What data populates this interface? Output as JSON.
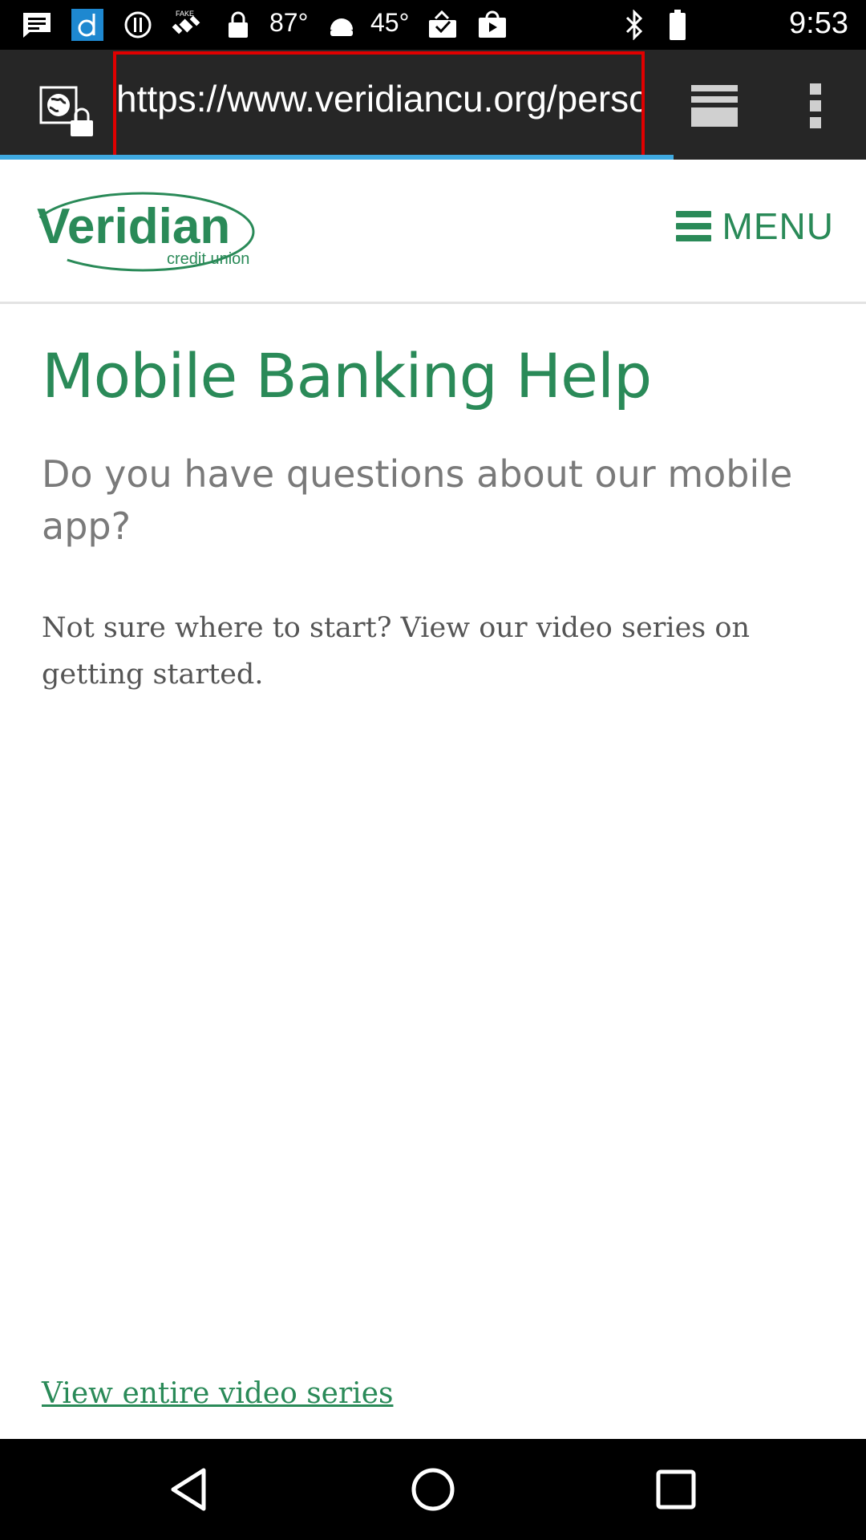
{
  "status_bar": {
    "temp1": "87°",
    "temp2": "45°",
    "time": "9:53",
    "icons": [
      "message-icon",
      "app-d-icon",
      "alert-circle-icon",
      "fake-gps-icon",
      "lock-icon",
      "temperature-87",
      "android-icon",
      "temperature-45",
      "download-done-icon",
      "play-store-icon",
      "bluetooth-icon",
      "battery-icon"
    ]
  },
  "browser": {
    "url": "https://www.veridiancu.org/personal/mobile-banking-help",
    "highlight_color": "#e00000",
    "progress_color": "#3fa9e0"
  },
  "site": {
    "logo_name": "Veridian",
    "logo_tagline": "credit union",
    "menu_label": "MENU",
    "brand_color": "#2a8a58"
  },
  "content": {
    "title": "Mobile Banking Help",
    "lead": "Do you have questions about our mobile app?",
    "body": "Not sure where to start? View our video series on getting started.",
    "link": "View entire video series"
  },
  "nav": {
    "icons": [
      "back-icon",
      "home-icon",
      "recents-icon"
    ]
  }
}
